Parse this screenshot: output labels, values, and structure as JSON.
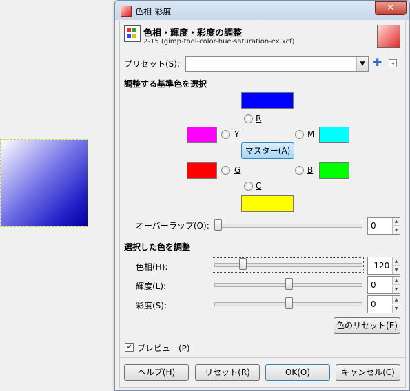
{
  "window": {
    "title": "色相-彩度",
    "close_label": "✕"
  },
  "header": {
    "title": "色相・輝度・彩度の調整",
    "subtitle": "2-15 (gimp-tool-color-hue-saturation-ex.xcf)"
  },
  "presets": {
    "label": "プリセット(S):",
    "value": ""
  },
  "select_color": {
    "title": "調整する基準色を選択",
    "radios": {
      "R": "R",
      "Y": "Y",
      "M": "M",
      "G": "G",
      "B": "B",
      "C": "C"
    },
    "master_label": "マスター(A)",
    "swatches": {
      "R": "#0000ff",
      "Y": "#ff00ff",
      "M": "#00ffff",
      "G": "#ff0000",
      "B": "#00ff00",
      "C": "#ffff00"
    }
  },
  "overlap": {
    "label": "オーバーラップ(O):",
    "value": "0",
    "level": 0
  },
  "adjust": {
    "title": "選択した色を調整",
    "hue": {
      "label": "色相(H):",
      "value": "-120",
      "level": 0.167
    },
    "lightness": {
      "label": "輝度(L):",
      "value": "0",
      "level": 0.5
    },
    "saturation": {
      "label": "彩度(S):",
      "value": "0",
      "level": 0.5
    },
    "reset_color_label": "色のリセット(E)"
  },
  "preview": {
    "label": "プレビュー(P)",
    "checked": true
  },
  "buttons": {
    "help": "ヘルプ(H)",
    "reset": "リセット(R)",
    "ok": "OK(O)",
    "cancel": "キャンセル(C)"
  }
}
